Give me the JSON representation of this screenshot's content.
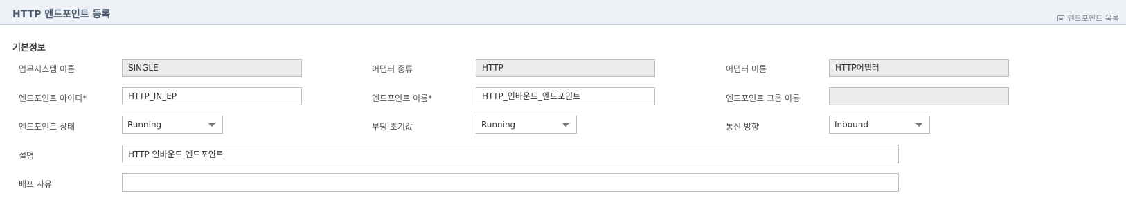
{
  "header": {
    "title": "HTTP 엔드포인트 등록",
    "list_link": "엔드포인트 목록"
  },
  "section": {
    "title": "기본정보"
  },
  "fields": {
    "business_system": {
      "label": "업무시스템 이름",
      "value": "SINGLE"
    },
    "adapter_type": {
      "label": "어댑터 종류",
      "value": "HTTP"
    },
    "adapter_name": {
      "label": "어댑터 이름",
      "value": "HTTP어댑터"
    },
    "endpoint_id": {
      "label": "엔드포인트 아이디*",
      "value": "HTTP_IN_EP"
    },
    "endpoint_name": {
      "label": "엔드포인트 이름*",
      "value": "HTTP_인바운드_엔드포인트"
    },
    "endpoint_group": {
      "label": "엔드포인트 그룹 이름",
      "value": ""
    },
    "endpoint_status": {
      "label": "엔드포인트 상태",
      "value": "Running"
    },
    "boot_initial": {
      "label": "부팅 초기값",
      "value": "Running"
    },
    "direction": {
      "label": "통신 방향",
      "value": "Inbound"
    },
    "description": {
      "label": "설명",
      "value": "HTTP 인바운드 엔드포인트"
    },
    "deploy_reason": {
      "label": "배포 사유",
      "value": ""
    }
  }
}
